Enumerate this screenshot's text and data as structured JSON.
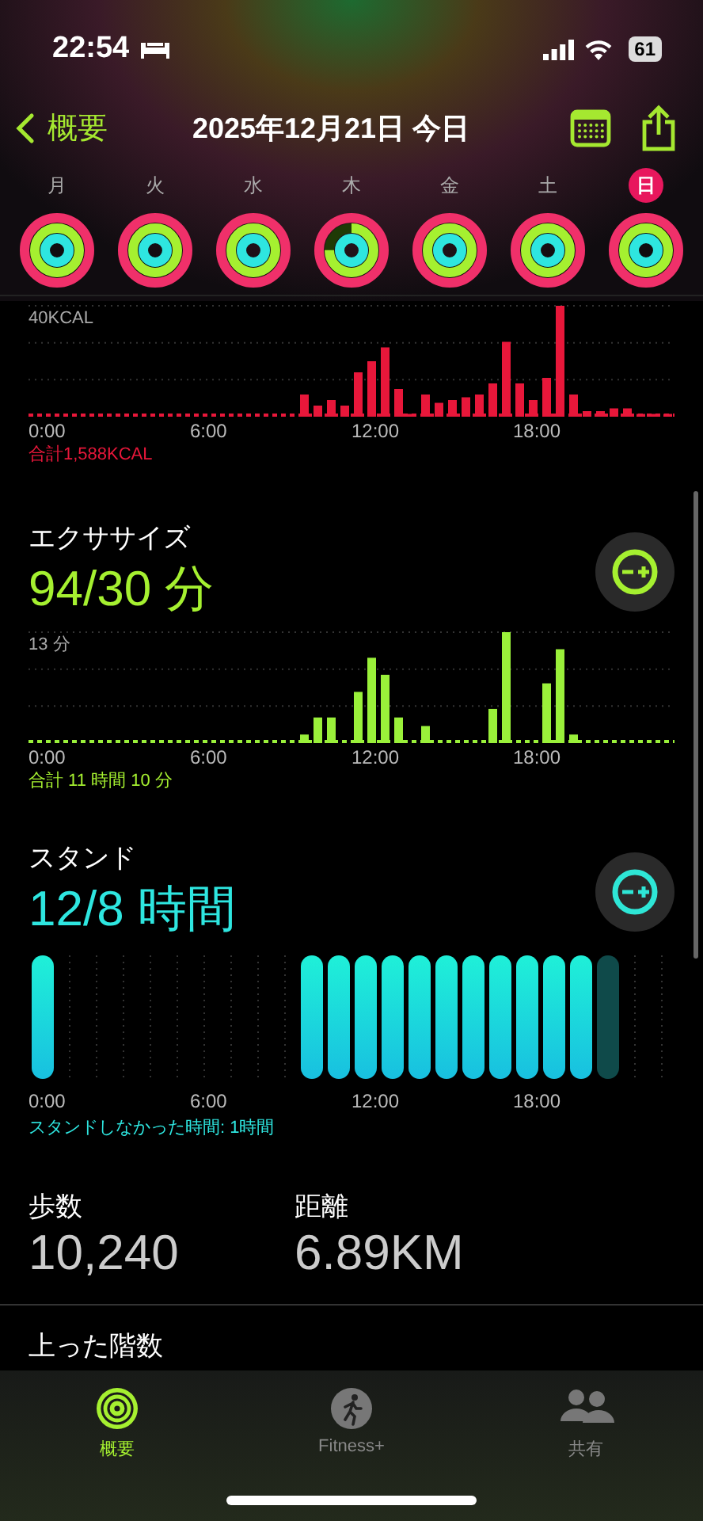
{
  "status_bar": {
    "time": "22:54",
    "battery": "61"
  },
  "nav": {
    "back": "概要",
    "title": "2025年12月21日 今日"
  },
  "week": [
    {
      "day": "月",
      "selected": false,
      "kind": "closed"
    },
    {
      "day": "火",
      "selected": false,
      "kind": "closed"
    },
    {
      "day": "水",
      "selected": false,
      "kind": "closed"
    },
    {
      "day": "木",
      "selected": false,
      "kind": "open"
    },
    {
      "day": "金",
      "selected": false,
      "kind": "closed"
    },
    {
      "day": "土",
      "selected": false,
      "kind": "closed"
    },
    {
      "day": "日",
      "selected": true,
      "kind": "closed"
    }
  ],
  "move": {
    "scale_label": "40KCAL",
    "axis_labels": [
      "0:00",
      "6:00",
      "12:00",
      "18:00"
    ],
    "total": "合計1,588KCAL"
  },
  "exercise": {
    "title": "エクササイズ",
    "value": "94/30 分",
    "scale_label": "13 分",
    "axis_labels": [
      "0:00",
      "6:00",
      "12:00",
      "18:00"
    ],
    "total": "合計 11 時間 10 分"
  },
  "stand": {
    "title": "スタンド",
    "value": "12/8 時間",
    "note": "スタンドしなかった時間: 1時間",
    "xticks": [
      "0:00",
      "6:00",
      "12:00",
      "18:00"
    ],
    "hours": [
      {
        "kind": "stood"
      },
      {
        "kind": "none"
      },
      {
        "kind": "none"
      },
      {
        "kind": "none"
      },
      {
        "kind": "none"
      },
      {
        "kind": "none"
      },
      {
        "kind": "none"
      },
      {
        "kind": "none"
      },
      {
        "kind": "none"
      },
      {
        "kind": "none"
      },
      {
        "kind": "stood"
      },
      {
        "kind": "stood"
      },
      {
        "kind": "stood"
      },
      {
        "kind": "stood"
      },
      {
        "kind": "stood"
      },
      {
        "kind": "stood"
      },
      {
        "kind": "stood"
      },
      {
        "kind": "stood"
      },
      {
        "kind": "stood"
      },
      {
        "kind": "stood"
      },
      {
        "kind": "stood"
      },
      {
        "kind": "missed"
      },
      {
        "kind": "none"
      },
      {
        "kind": "none"
      }
    ]
  },
  "stats": [
    {
      "label": "歩数",
      "value": "10,240"
    },
    {
      "label": "距離",
      "value": "6.89KM"
    }
  ],
  "floors": {
    "label": "上った階数"
  },
  "tab_bar": [
    {
      "label": "概要",
      "selected": true
    },
    {
      "label": "Fitness+",
      "selected": false
    },
    {
      "label": "共有",
      "selected": false
    }
  ]
}
